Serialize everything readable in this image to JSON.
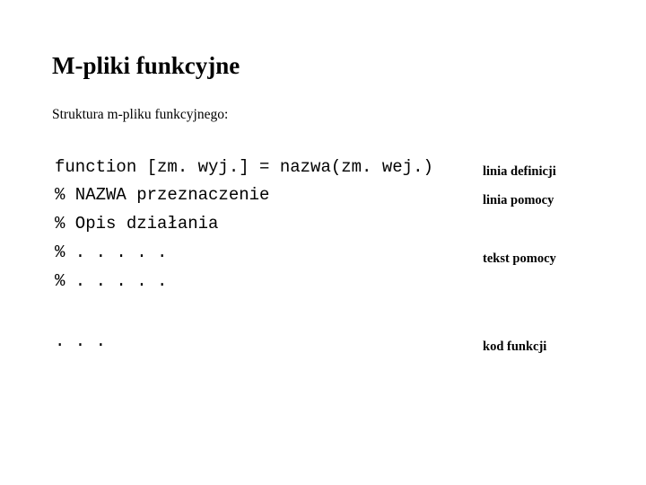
{
  "slide": {
    "title": "M-pliki funkcyjne",
    "subtitle": "Struktura m-pliku funkcyjnego:",
    "background_color": "#ffffff",
    "text_color": "#000000"
  },
  "code": {
    "lines": [
      "function [zm. wyj.] = nazwa(zm. wej.)",
      "% NAZWA przeznaczenie",
      "% Opis działania",
      "% . . . . .",
      "% . . . . .",
      ". . ."
    ]
  },
  "annotations": {
    "definition_line": "linia definicji",
    "help_line": "linia pomocy",
    "help_text": "tekst pomocy",
    "function_code": "kod funkcji"
  }
}
